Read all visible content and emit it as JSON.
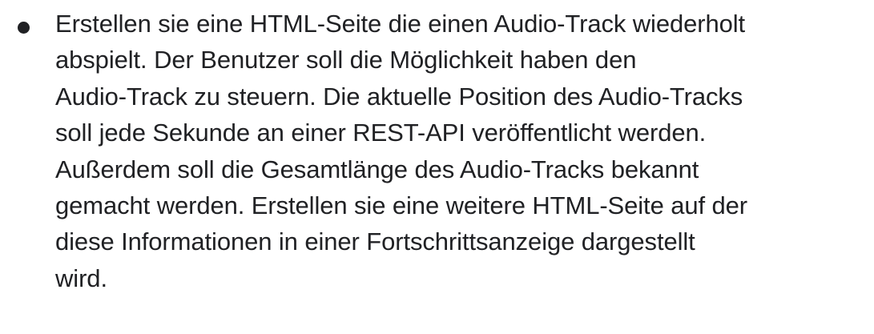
{
  "document": {
    "bullet_points": [
      {
        "lines": [
          "Erstellen sie eine HTML-Seite die einen Audio-Track wiederholt",
          "abspielt. Der Benutzer soll die Möglichkeit haben den",
          "Audio-Track zu steuern. Die aktuelle Position des Audio-Tracks",
          "soll jede Sekunde an einer REST-API veröffentlicht werden.",
          "Außerdem soll die Gesamtlänge des Audio-Tracks bekannt",
          "gemacht werden. Erstellen sie eine weitere HTML-Seite auf der",
          "diese Informationen in einer Fortschrittsanzeige dargestellt",
          "wird."
        ]
      }
    ]
  }
}
